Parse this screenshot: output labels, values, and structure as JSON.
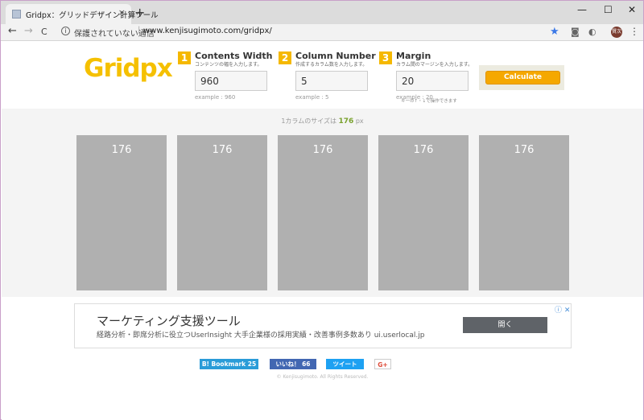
{
  "browser": {
    "tab_title": "Gridpx：グリッドデザイン計算ツール",
    "tab_close": "×",
    "new_tab": "+",
    "minimize": "—",
    "maximize": "☐",
    "close": "✕",
    "back": "←",
    "forward": "→",
    "reload": "C",
    "security_text": "保護されていない通信",
    "url": "www.kenjisugimoto.com/gridpx/",
    "avatar_text": "賢次",
    "menu": "⋮"
  },
  "logo": "Gridpx",
  "fields": [
    {
      "num": "1",
      "title": "Contents  Width",
      "desc": "コンテンツの幅を入力します。",
      "value": "960",
      "hint": "",
      "example": "example : 960"
    },
    {
      "num": "2",
      "title": "Column  Number",
      "desc": "作成するカラム数を入力します。",
      "value": "5",
      "hint": "",
      "example": "example : 5"
    },
    {
      "num": "3",
      "title": "Margin",
      "desc": "カラム間のマージンを入力します。",
      "value": "20",
      "hint": "キーの↑・↓で操作できます",
      "example": "example : 20"
    }
  ],
  "calculate_label": "Calculate",
  "result": {
    "prefix": "1カラムのサイズは",
    "value": "176",
    "unit": "px"
  },
  "columns": [
    "176",
    "176",
    "176",
    "176",
    "176"
  ],
  "ad": {
    "title": "マーケティング支援ツール",
    "desc": "経路分析・即席分析に役立つUserInsight 大手企業様の採用実績・改善事例多数あり ui.userlocal.jp",
    "button": "開く",
    "badge": "ⓘ ✕"
  },
  "share": {
    "bookmark": "B! Bookmark 25",
    "like": "いいね！ 66",
    "tweet": "ツイート",
    "gplus": "G+"
  },
  "copyright": "© Kenjisugimoto. All Rights Reserved.",
  "colors": {
    "accent": "#f5b800",
    "column": "#b0b0b0",
    "result_value": "#7aa22e"
  }
}
